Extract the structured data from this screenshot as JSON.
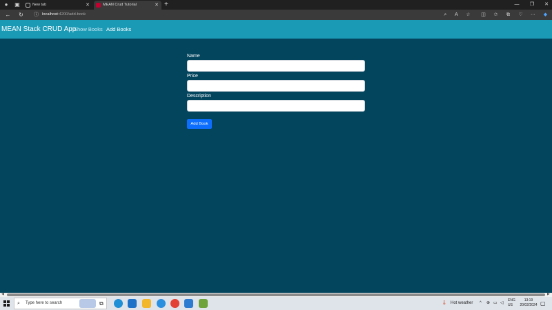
{
  "browser": {
    "tabs": [
      {
        "title": "New tab",
        "favicon": "page-icon"
      },
      {
        "title": "MEAN Crud Tutorial",
        "favicon": "angular-icon"
      }
    ],
    "address": {
      "host": "localhost",
      "path": ":4200/add-book"
    }
  },
  "app": {
    "brand": "MEAN Stack CRUD App",
    "nav": {
      "show_books": "Show Books",
      "add_books": "Add Books"
    }
  },
  "form": {
    "name_label": "Name",
    "price_label": "Price",
    "description_label": "Description",
    "name_value": "",
    "price_value": "",
    "description_value": "",
    "submit_label": "Add Book"
  },
  "taskbar": {
    "search_placeholder": "Type here to search",
    "weather": "Hot weather",
    "lang_line1": "ENG",
    "lang_line2": "US",
    "time": "13:19",
    "date": "20/02/2024"
  },
  "colors": {
    "page_bg": "#04455e",
    "navbar_bg": "#1b9ab6",
    "button_primary": "#0d6efd"
  }
}
